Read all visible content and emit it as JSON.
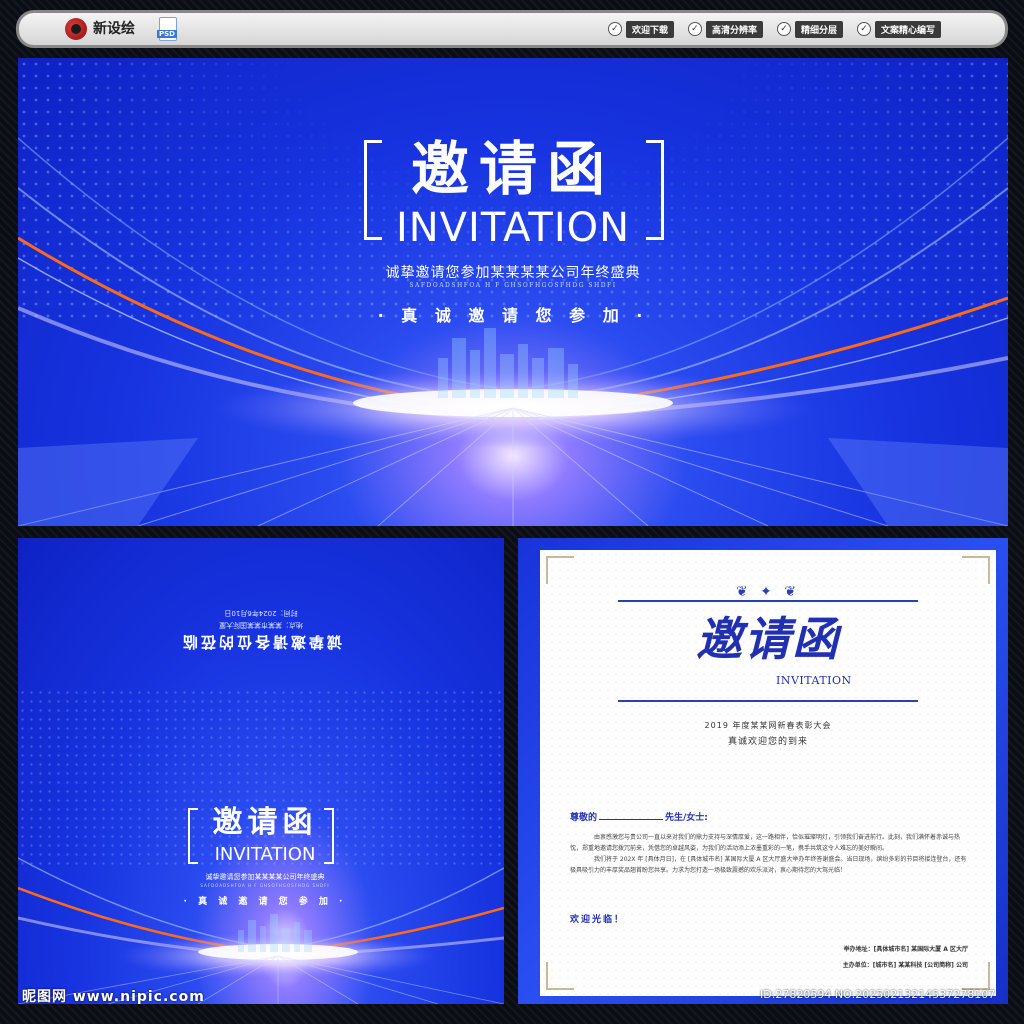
{
  "banner": {
    "brand_name": "新设绘",
    "file_badge": "PSD",
    "features": [
      "欢迎下载",
      "高清分辨率",
      "精细分层",
      "文案精心编写"
    ]
  },
  "hero": {
    "title_cn": "邀请函",
    "title_en": "INVITATION",
    "subtitle": "诚挚邀请您参加某某某某公司年终盛典",
    "subtitle_en": "SAFDOADSHFOA H F GHSOFHGOSFHDG SHDFI",
    "tagline": "· 真 诚 邀 请 您 参 加 ·"
  },
  "cover": {
    "back_line1": "诚挚邀请各位的莅临",
    "back_line2": "地点：某某市某某国际大厦",
    "back_line3": "时间：2024年6月10日",
    "title_cn": "邀请函",
    "title_en": "INVITATION",
    "subtitle": "诚挚邀请您参加某某某某公司年终盛典",
    "subtitle_en": "SAFDOADSHFOA H F GHSOFHGOSFHDG SHDFI",
    "tagline": "· 真 诚 邀 请 您 参 加 ·"
  },
  "letter": {
    "title_cn": "邀请函",
    "title_en": "INVITATION",
    "event": "2019 年度某某网新春表彰大会",
    "welcome": "真诚欢迎您的到来",
    "salutation_pre": "尊敬的",
    "salutation_post": "先生/女士:",
    "para1": "由衷感激您与贵公司一直以来对我们的鼎力支持与深情厚爱，这一路相伴，恰似璀璨明灯，引领我们奋进前行。此刻，我们满怀着赤诚与热忱，郑重地邀请您拨冗前来，凭借您的卓越风姿，为我们的活动添上浓墨重彩的一笔，携手共筑这令人难忘的美好瞬间。",
    "para2": "我们将于 202X 年 [具体月日]，在 [具体城市名] 某国际大厦 A 区大厅盛大举办年终答谢盛会。当日现场，缤纷多彩的节目将接连登台，还有极具吸引力的丰厚奖品翘首盼您共享。力求为您打造一场极致震撼的欢乐派对，衷心期待您的大驾光临！",
    "closing": "欢迎光临！",
    "host": "举办地址：[具体城市名] 某国际大厦 A 区大厅",
    "organizer": "主办单位：[城市名] 某某科技 [公司简称] 公司"
  },
  "watermark": {
    "site": "昵图网 www.nipic.com",
    "id": "ID:27820594 NO:20250213214537278107"
  },
  "colors": {
    "accent_blue": "#1734e0",
    "orange_streak": "#ff6a1a",
    "ink_blue": "#2030b0"
  }
}
